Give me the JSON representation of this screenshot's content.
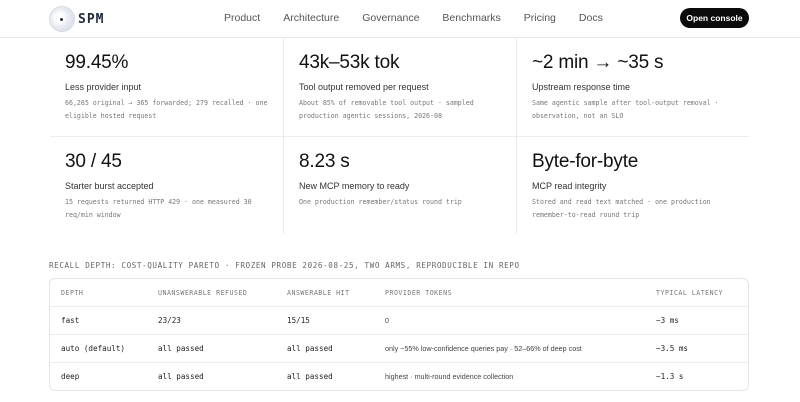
{
  "nav": {
    "logo_text": "SPM",
    "links": [
      "Product",
      "Architecture",
      "Governance",
      "Benchmarks",
      "Pricing",
      "Docs"
    ],
    "cta": "Open console"
  },
  "stats": [
    {
      "value": "99.45%",
      "label": "Less provider input",
      "note": "66,265 original → 365 forwarded; 279 recalled · one eligible hosted request"
    },
    {
      "value": "43k–53k tok",
      "label": "Tool output removed per request",
      "note": "About 85% of removable tool output · sampled production agentic sessions, 2026-08"
    },
    {
      "value": "~2 min → ~35 s",
      "label": "Upstream response time",
      "note": "Same agentic sample after tool-output removal · observation, not an SLO"
    },
    {
      "value": "30 / 45",
      "label": "Starter burst accepted",
      "note": "15 requests returned HTTP 429 · one measured 30 req/min window"
    },
    {
      "value": "8.23 s",
      "label": "New MCP memory to ready",
      "note": "One production remember/status round trip"
    },
    {
      "value": "Byte-for-byte",
      "label": "MCP read integrity",
      "note": "Stored and read text matched · one production remember-to-read round trip"
    }
  ],
  "recall": {
    "caption": "RECALL DEPTH: COST-QUALITY PARETO · FROZEN PROBE 2026-08-25, TWO ARMS, REPRODUCIBLE IN REPO",
    "headers": [
      "DEPTH",
      "UNANSWERABLE REFUSED",
      "ANSWERABLE HIT",
      "PROVIDER TOKENS",
      "TYPICAL LATENCY"
    ],
    "rows": [
      {
        "depth": "fast",
        "refused": "23/23",
        "hit": "15/15",
        "tokens": "0",
        "latency": "~3 ms"
      },
      {
        "depth": "auto (default)",
        "refused": "all passed",
        "hit": "all passed",
        "tokens": "only ~55% low-confidence queries pay · 52–66% of deep cost",
        "latency": "~3.5 ms"
      },
      {
        "depth": "deep",
        "refused": "all passed",
        "hit": "all passed",
        "tokens": "highest · multi-round evidence collection",
        "latency": "~1.3 s"
      }
    ]
  }
}
